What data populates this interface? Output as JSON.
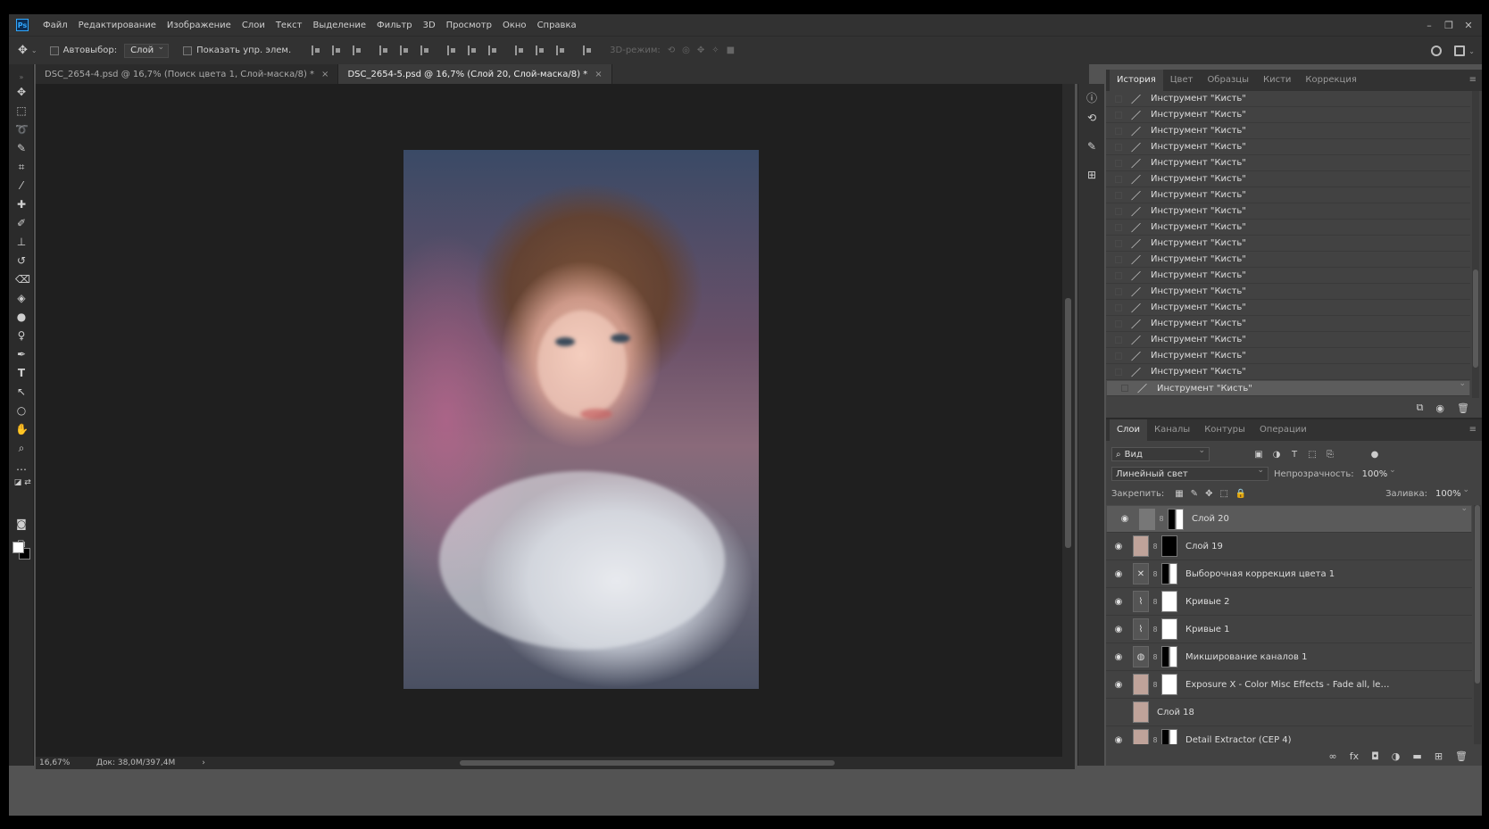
{
  "menu": [
    "Файл",
    "Редактирование",
    "Изображение",
    "Слои",
    "Текст",
    "Выделение",
    "Фильтр",
    "3D",
    "Просмотр",
    "Окно",
    "Справка"
  ],
  "options": {
    "autoselect_label": "Автовыбор:",
    "autoselect_value": "Слой",
    "show_controls_label": "Показать упр. элем.",
    "mode3d_label": "3D-режим:"
  },
  "tabs": [
    {
      "title": "DSC_2654-4.psd @ 16,7% (Поиск цвета 1, Слой-маска/8) *",
      "close": "×"
    },
    {
      "title": "DSC_2654-5.psd @ 16,7% (Слой 20, Слой-маска/8) *",
      "close": "×"
    }
  ],
  "status": {
    "zoom": "16,67%",
    "doc": "Док: 38,0M/397,4M",
    "arrow": "›"
  },
  "history": {
    "tabs": [
      "История",
      "Цвет",
      "Образцы",
      "Кисти",
      "Коррекция"
    ],
    "items": [
      "Инструмент \"Кисть\"",
      "Инструмент \"Кисть\"",
      "Инструмент \"Кисть\"",
      "Инструмент \"Кисть\"",
      "Инструмент \"Кисть\"",
      "Инструмент \"Кисть\"",
      "Инструмент \"Кисть\"",
      "Инструмент \"Кисть\"",
      "Инструмент \"Кисть\"",
      "Инструмент \"Кисть\"",
      "Инструмент \"Кисть\"",
      "Инструмент \"Кисть\"",
      "Инструмент \"Кисть\"",
      "Инструмент \"Кисть\"",
      "Инструмент \"Кисть\"",
      "Инструмент \"Кисть\"",
      "Инструмент \"Кисть\"",
      "Инструмент \"Кисть\"",
      "Инструмент \"Кисть\""
    ]
  },
  "layers": {
    "tabs": [
      "Слои",
      "Каналы",
      "Контуры",
      "Операции"
    ],
    "filter_label": "Вид",
    "blend_mode": "Линейный свет",
    "opacity_label": "Непрозрачность:",
    "opacity_value": "100%",
    "lock_label": "Закрепить:",
    "fill_label": "Заливка:",
    "fill_value": "100%",
    "items": [
      {
        "name": "Слой 20"
      },
      {
        "name": "Слой 19"
      },
      {
        "name": "Выборочная коррекция цвета 1"
      },
      {
        "name": "Кривые 2"
      },
      {
        "name": "Кривые 1"
      },
      {
        "name": "Микширование каналов 1"
      },
      {
        "name": "Exposure X - Color Misc Effects - Fade all, leav..."
      },
      {
        "name": "Слой 18"
      },
      {
        "name": "Detail Extractor  (CEP 4)"
      }
    ]
  },
  "icons": {
    "move": "move-icon",
    "brush": "brush-icon",
    "eye": "eye-icon",
    "chain": "link-icon"
  }
}
